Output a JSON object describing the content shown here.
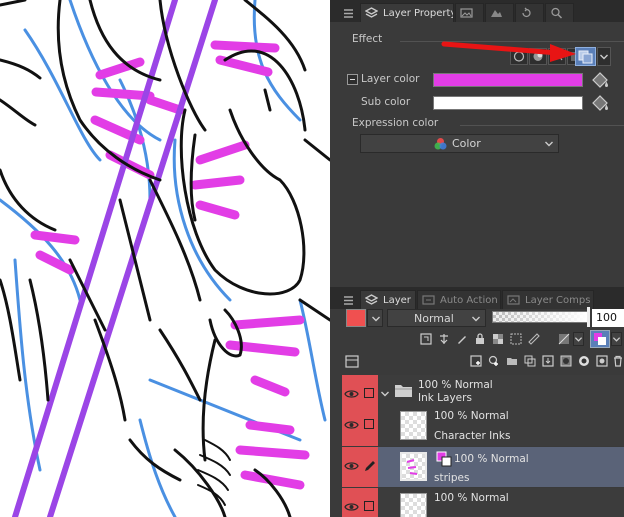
{
  "layer_property_panel": {
    "tabs": [
      {
        "label": "Layer Property",
        "icon": "layer-property-icon"
      },
      {
        "label": "",
        "icon": "image-icon"
      },
      {
        "label": "",
        "icon": "mountain-icon"
      },
      {
        "label": "",
        "icon": "rotate-icon"
      },
      {
        "label": "",
        "icon": "search-icon"
      }
    ],
    "effect_label": "Effect",
    "layer_color_label": "Layer color",
    "layer_color_value": "#e23de6",
    "sub_color_label": "Sub color",
    "sub_color_value": "#ffffff",
    "expression_color_label": "Expression color",
    "expression_color_value": "Color"
  },
  "layer_panel": {
    "tabs": [
      {
        "label": "Layer",
        "icon": "layers-icon"
      },
      {
        "label": "Auto Action",
        "icon": "auto-action-icon"
      },
      {
        "label": "Layer Comps",
        "icon": "layer-comps-icon"
      }
    ],
    "blend_mode": "Normal",
    "opacity": "100",
    "main_color": "#f05050",
    "layers": [
      {
        "line1": "100 % Normal",
        "line2": "Ink Layers",
        "type": "folder",
        "selected": false
      },
      {
        "line1": "100 % Normal",
        "line2": "Character Inks",
        "type": "raster",
        "selected": false
      },
      {
        "line1": "100 % Normal",
        "line2": "stripes",
        "type": "raster",
        "selected": true
      },
      {
        "line1": "100 % Normal",
        "line2": "",
        "type": "raster",
        "selected": false
      }
    ]
  },
  "colors": {
    "panel_bg": "#3a3a3a",
    "selected_row": "#5a6378",
    "visibility_column": "#e05055",
    "stripe_magenta": "#e23de6",
    "line_purple": "#9b45e6",
    "line_blue": "#4a90e2",
    "annotation_arrow": "#e81414"
  }
}
